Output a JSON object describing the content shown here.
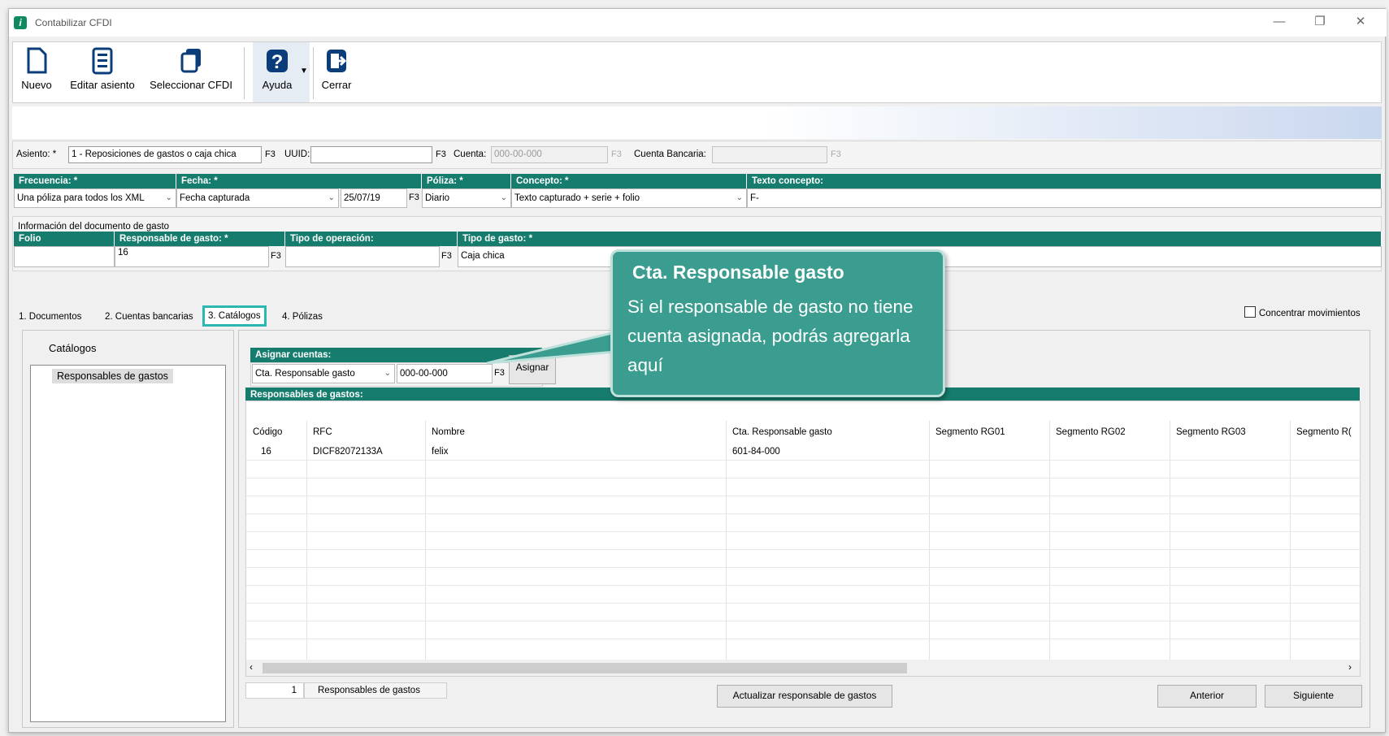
{
  "window": {
    "title": "Contabilizar CFDI",
    "icon": "cfdi-app-icon"
  },
  "toolbar": {
    "nuevo": "Nuevo",
    "editar": "Editar asiento",
    "seleccionar": "Seleccionar CFDI",
    "ayuda": "Ayuda",
    "cerrar": "Cerrar"
  },
  "asiento": {
    "label": "Asiento: *",
    "value": "1 - Reposiciones de gastos o caja chica",
    "f3": "F3",
    "uuid_label": "UUID:",
    "uuid_value": "",
    "cuenta_label": "Cuenta:",
    "cuenta_value": "000-00-000",
    "cuenta_bancaria_label": "Cuenta Bancaria:",
    "cuenta_bancaria_value": ""
  },
  "poliza_config": {
    "headers": [
      "Frecuencia: *",
      "Fecha: *",
      "Póliza: *",
      "Concepto: *",
      "Texto concepto:"
    ],
    "frecuencia": "Una póliza para todos los XML",
    "fecha_tipo": "Fecha capturada",
    "fecha": "25/07/19",
    "poliza": "Diario",
    "concepto": "Texto capturado + serie + folio",
    "texto_concepto": "F-"
  },
  "documento_gasto": {
    "title": "Información del documento de gasto",
    "headers": [
      "Folio",
      "Responsable de gasto: *",
      "Tipo de operación:",
      "Tipo de gasto: *"
    ],
    "folio": "",
    "responsable": "16",
    "tipo_operacion": "",
    "tipo_gasto": "Caja chica"
  },
  "tabs": [
    "1. Documentos",
    "2. Cuentas bancarias",
    "3. Catálogos",
    "4. Pólizas"
  ],
  "concentrar": "Concentrar movimientos",
  "catalogos": {
    "title": "Catálogos",
    "items": [
      "Responsables de gastos"
    ]
  },
  "asignar": {
    "header": "Asignar cuentas:",
    "tipo": "Cta. Responsable gasto",
    "cuenta": "000-00-000",
    "button": "Asignar"
  },
  "grid": {
    "title": "Responsables de gastos:",
    "columns": [
      "Código",
      "RFC",
      "Nombre",
      "Cta. Responsable gasto",
      "Segmento RG01",
      "Segmento RG02",
      "Segmento RG03",
      "Segmento R("
    ],
    "rows": [
      [
        "16",
        "DICF82072133A",
        "felix",
        "601-84-000",
        "",
        "",
        "",
        ""
      ]
    ]
  },
  "footer": {
    "count": "1",
    "count_label": "Responsables de gastos",
    "actualizar": "Actualizar responsable de gastos",
    "anterior": "Anterior",
    "siguiente": "Siguiente"
  },
  "callout": {
    "title": "Cta. Responsable gasto",
    "body": "Si el responsable de gasto no tiene cuenta asignada, podrás agregarla aquí"
  },
  "colors": {
    "teal": "#167d6e",
    "callout": "#3a9d8f",
    "highlight": "#2bb8b0"
  }
}
